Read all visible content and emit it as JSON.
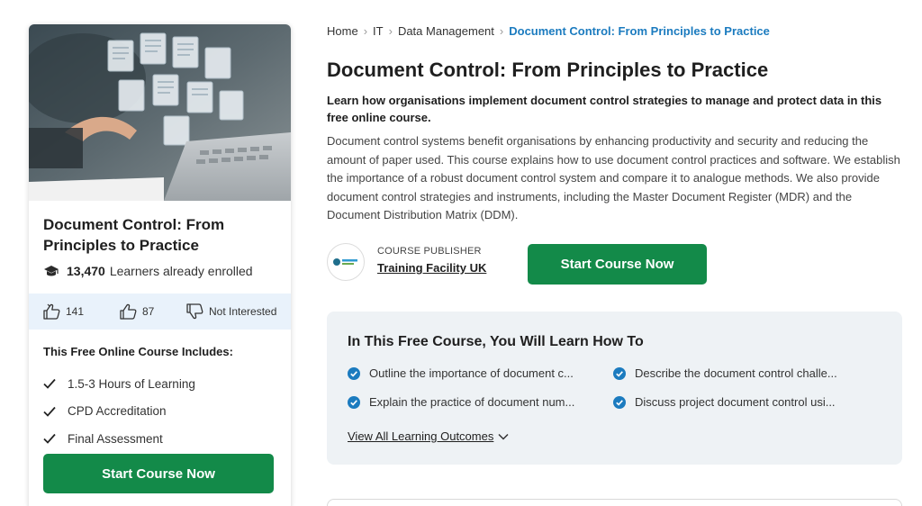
{
  "breadcrumb": {
    "items": [
      "Home",
      "IT",
      "Data Management"
    ],
    "current": "Document Control: From Principles to Practice"
  },
  "course": {
    "title": "Document Control: From Principles to Practice",
    "subtitle": "Learn how organisations implement document control strategies to manage and protect data in this free online course.",
    "description": "Document control systems benefit organisations by enhancing productivity and security and reducing the amount of paper used. This course explains how to use document control practices and software. We establish the importance of a robust document control system and compare it to analogue methods. We also provide document control strategies and instruments, including the Master Document Register (MDR) and the Document Distribution Matrix (DDM)."
  },
  "card": {
    "title": "Document Control: From Principles to Practice",
    "learners_count": "13,470",
    "learners_label": "Learners already enrolled",
    "likes": "141",
    "dislikes": "87",
    "not_interested": "Not Interested",
    "includes_title": "This Free Online Course Includes:",
    "includes": [
      "1.5-3 Hours of Learning",
      "CPD Accreditation",
      "Final Assessment"
    ],
    "start_label": "Start Course Now"
  },
  "publisher": {
    "label": "COURSE PUBLISHER",
    "name": "Training Facility UK"
  },
  "main_start_label": "Start Course Now",
  "outcomes": {
    "title": "In This Free Course, You Will Learn How To",
    "items": [
      "Outline the importance of document c...",
      "Describe the document control challe...",
      "Explain the practice of document num...",
      "Discuss project document control usi..."
    ],
    "view_all": "View All Learning Outcomes"
  },
  "colors": {
    "primary_green": "#138a49",
    "link_blue": "#1b7bbf",
    "feedback_bg": "#e9f2fb",
    "outcomes_bg": "#eef2f5"
  },
  "icons": [
    "graduation-cap-icon",
    "thumbs-up-icon",
    "thumbs-down-icon",
    "not-interested-icon",
    "check-icon",
    "check-circle-icon",
    "chevron-down-icon"
  ]
}
